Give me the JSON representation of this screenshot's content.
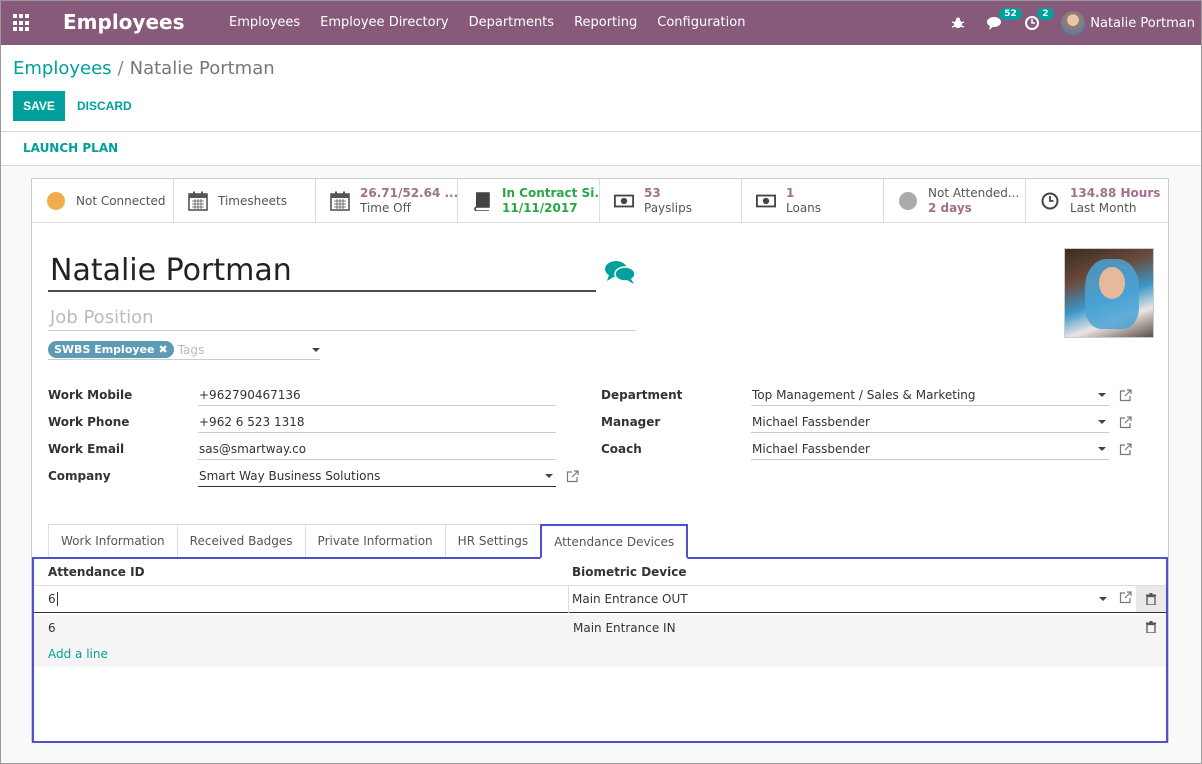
{
  "topbar": {
    "app_title": "Employees",
    "menu": [
      "Employees",
      "Employee Directory",
      "Departments",
      "Reporting",
      "Configuration"
    ],
    "messages_count": "52",
    "activities_count": "2",
    "user_name": "Natalie Portman"
  },
  "breadcrumb": {
    "parent": "Employees",
    "separator": "/",
    "current": "Natalie Portman"
  },
  "buttons": {
    "save": "SAVE",
    "discard": "DISCARD",
    "launch_plan": "LAUNCH PLAN"
  },
  "smart_buttons": [
    {
      "line1": "Not Connected",
      "line2": "",
      "icon": "status-dot",
      "color": "#f0ad4e"
    },
    {
      "line1": "Timesheets",
      "line2": "",
      "icon": "calendar-icon"
    },
    {
      "line1": "26.71/52.64 ...",
      "line2": "Time Off",
      "icon": "calendar-icon"
    },
    {
      "line1": "In Contract Si...",
      "line2": "11/11/2017",
      "icon": "book-icon"
    },
    {
      "line1": "53",
      "line2": "Payslips",
      "icon": "money-icon"
    },
    {
      "line1": "1",
      "line2": "Loans",
      "icon": "money-icon"
    },
    {
      "line1": "Not Attended...",
      "line2": "2 days",
      "icon": "status-dot",
      "color": "#aaaaaa"
    },
    {
      "line1": "134.88 Hours",
      "line2": "Last Month",
      "icon": "clock-icon"
    }
  ],
  "employee": {
    "name": "Natalie Portman",
    "job_position_placeholder": "Job Position",
    "tag": "SWBS Employee",
    "tags_placeholder": "Tags"
  },
  "left_fields": {
    "work_mobile_label": "Work Mobile",
    "work_mobile": "+962790467136",
    "work_phone_label": "Work Phone",
    "work_phone": "+962 6 523 1318",
    "work_email_label": "Work Email",
    "work_email": "sas@smartway.co",
    "company_label": "Company",
    "company": "Smart Way Business Solutions"
  },
  "right_fields": {
    "department_label": "Department",
    "department": "Top Management / Sales & Marketing",
    "manager_label": "Manager",
    "manager": "Michael Fassbender",
    "coach_label": "Coach",
    "coach": "Michael Fassbender"
  },
  "tabs": [
    "Work Information",
    "Received Badges",
    "Private Information",
    "HR Settings",
    "Attendance Devices"
  ],
  "attendance_table": {
    "col_id": "Attendance ID",
    "col_device": "Biometric Device",
    "rows": [
      {
        "id": "6",
        "device": "Main  Entrance OUT"
      },
      {
        "id": "6",
        "device": "Main Entrance IN"
      }
    ],
    "add_line": "Add a line"
  },
  "colors": {
    "brand": "#875a7b",
    "accent": "#00a09d",
    "focus_outline": "#4f4fd4"
  }
}
